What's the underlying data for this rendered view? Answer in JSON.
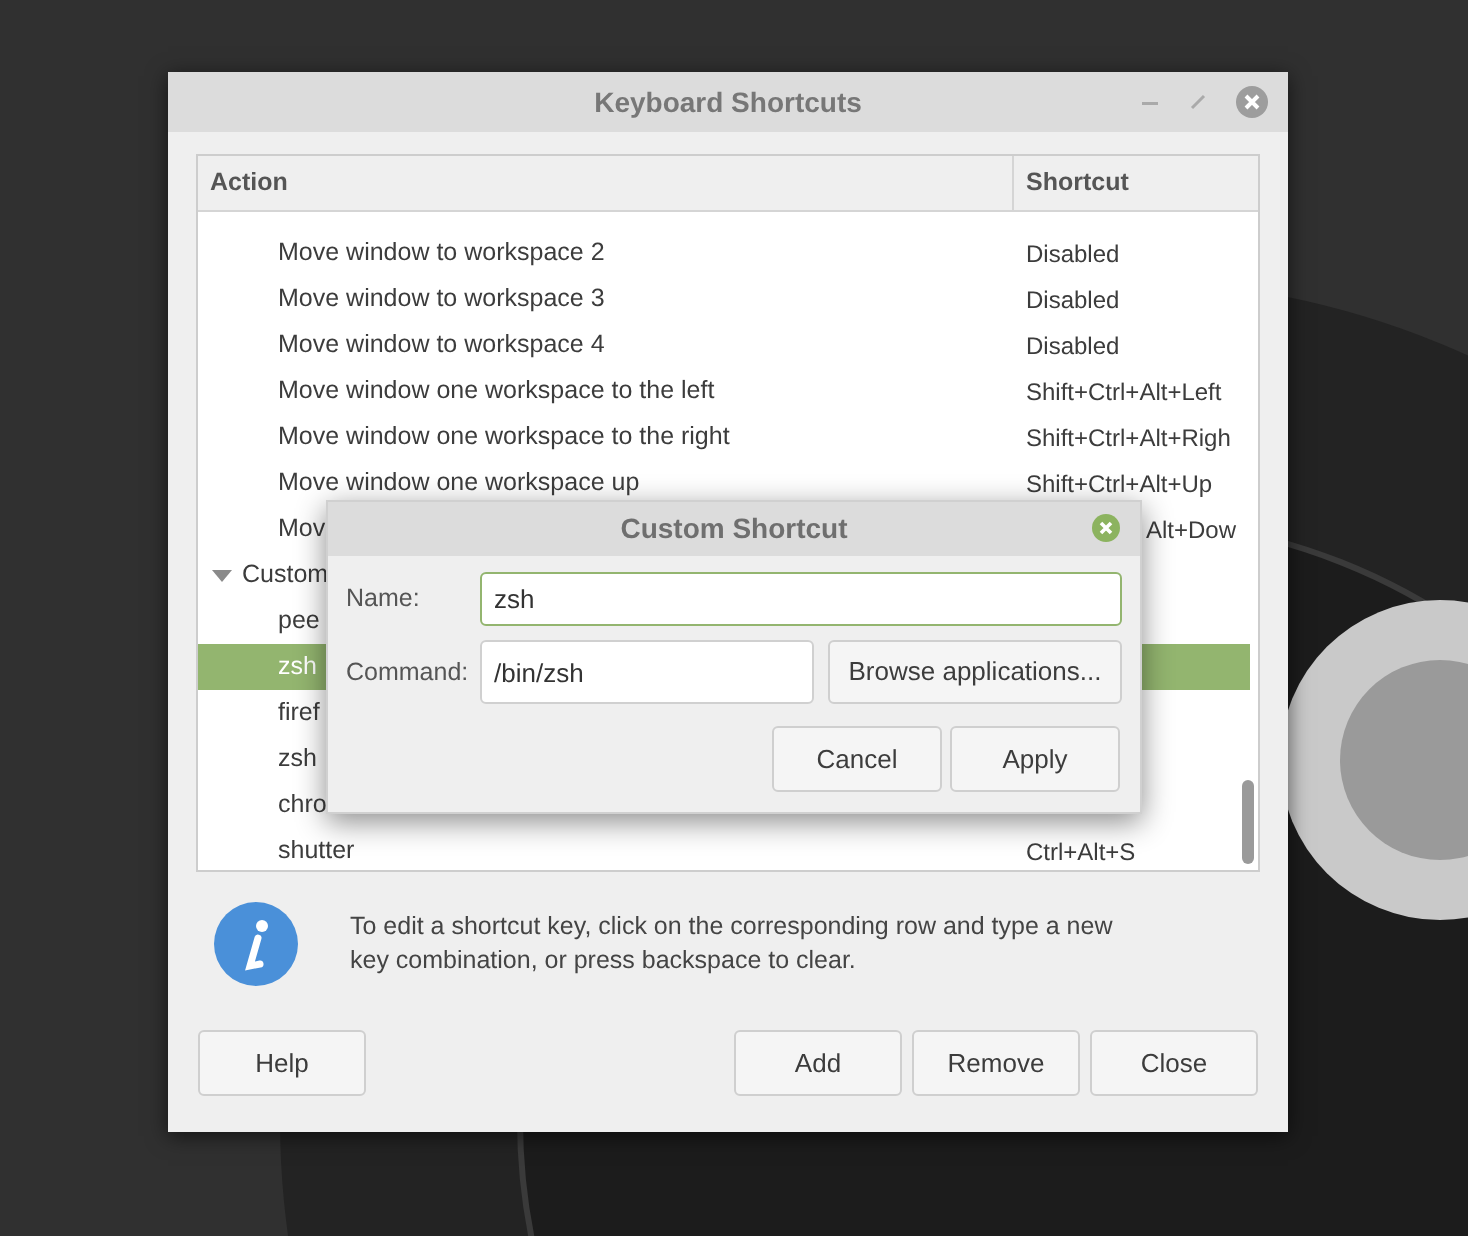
{
  "window": {
    "title": "Keyboard Shortcuts"
  },
  "table": {
    "columns": [
      "Action",
      "Shortcut"
    ],
    "rows": [
      {
        "kind": "row",
        "action": "Move window to workspace 2",
        "shortcut": "Disabled",
        "selected": false
      },
      {
        "kind": "row",
        "action": "Move window to workspace 3",
        "shortcut": "Disabled",
        "selected": false
      },
      {
        "kind": "row",
        "action": "Move window to workspace 4",
        "shortcut": "Disabled",
        "selected": false
      },
      {
        "kind": "row",
        "action": "Move window one workspace to the left",
        "shortcut": "Shift+Ctrl+Alt+Left",
        "selected": false
      },
      {
        "kind": "row",
        "action": "Move window one workspace to the right",
        "shortcut": "Shift+Ctrl+Alt+Righ",
        "selected": false
      },
      {
        "kind": "row",
        "action": "Move window one workspace up",
        "shortcut": "Shift+Ctrl+Alt+Up",
        "selected": false
      },
      {
        "kind": "covered",
        "action": "Mov",
        "shortcut": "Alt+Dow",
        "selected": false
      },
      {
        "kind": "group",
        "action": "Custom",
        "expanded": true,
        "children": [
          {
            "kind": "row",
            "action": "pee",
            "selected": false
          },
          {
            "kind": "row",
            "action": "zsh",
            "selected": true
          },
          {
            "kind": "row",
            "action": "firef",
            "selected": false
          },
          {
            "kind": "row",
            "action": "zsh",
            "selected": false
          },
          {
            "kind": "row",
            "action": "chro",
            "selected": false
          },
          {
            "kind": "row",
            "action": "shutter",
            "shortcut": "Ctrl+Alt+S",
            "selected": false
          }
        ]
      }
    ]
  },
  "info": "To edit a shortcut key, click on the corresponding row and type a new key combination, or press backspace to clear.",
  "buttons": {
    "left": [
      "Help"
    ],
    "right": [
      "Add",
      "Remove",
      "Close"
    ]
  },
  "dialog": {
    "title": "Custom Shortcut",
    "name_label": "Name:",
    "name_value": "zsh",
    "command_label": "Command:",
    "command_value": "/bin/zsh",
    "browse": "Browse applications...",
    "buttons": [
      "Cancel",
      "Apply"
    ]
  }
}
